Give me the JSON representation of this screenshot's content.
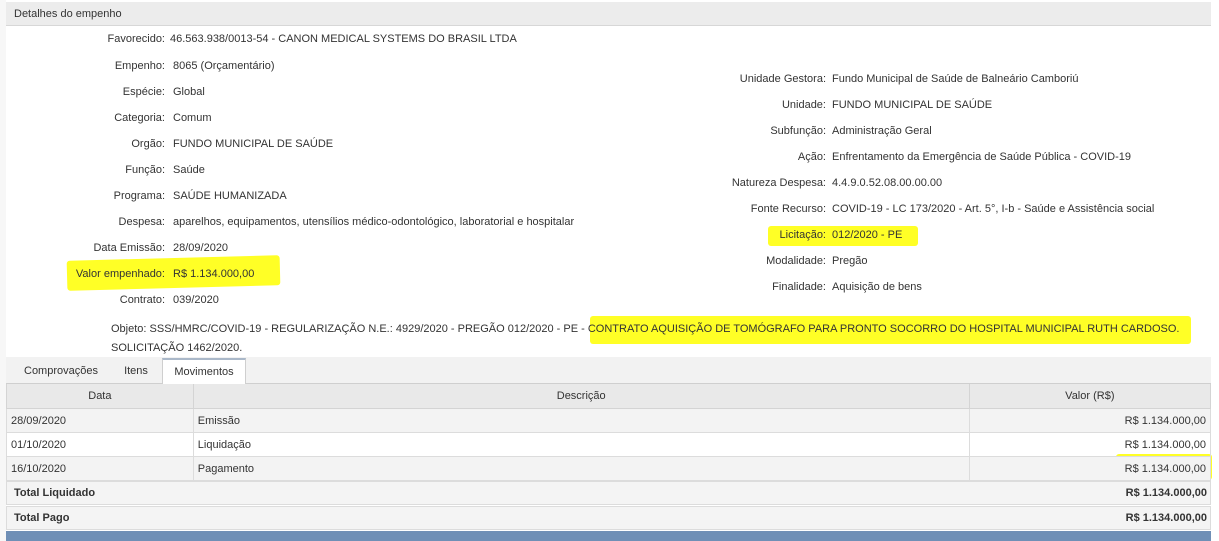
{
  "panel": {
    "title": "Detalhes do empenho"
  },
  "left_fields": [
    {
      "label": "Favorecido:",
      "value": "46.563.938/0013-54 - CANON MEDICAL SYSTEMS DO BRASIL LTDA"
    },
    {
      "label": "Empenho:",
      "value": "8065 (Orçamentário)"
    },
    {
      "label": "Espécie:",
      "value": "Global"
    },
    {
      "label": "Categoria:",
      "value": "Comum"
    },
    {
      "label": "Orgão:",
      "value": "FUNDO MUNICIPAL DE SAÚDE"
    },
    {
      "label": "Função:",
      "value": "Saúde"
    },
    {
      "label": "Programa:",
      "value": "SAÚDE HUMANIZADA"
    },
    {
      "label": "Despesa:",
      "value": "aparelhos, equipamentos, utensílios médico-odontológico, laboratorial e hospitalar"
    },
    {
      "label": "Data Emissão:",
      "value": "28/09/2020"
    },
    {
      "label": "Valor empenhado:",
      "value": "R$ 1.134.000,00"
    },
    {
      "label": "Contrato:",
      "value": "039/2020"
    }
  ],
  "right_fields": [
    {
      "label": "Unidade Gestora:",
      "value": "Fundo Municipal de Saúde de Balneário Camboriú"
    },
    {
      "label": "Unidade:",
      "value": "FUNDO MUNICIPAL DE SAÚDE"
    },
    {
      "label": "Subfunção:",
      "value": "Administração Geral"
    },
    {
      "label": "Ação:",
      "value": "Enfrentamento da Emergência de Saúde Pública - COVID-19"
    },
    {
      "label": "Natureza Despesa:",
      "value": "4.4.9.0.52.08.00.00.00"
    },
    {
      "label": "Fonte Recurso:",
      "value": "COVID-19 - LC 173/2020 - Art. 5°, I-b - Saúde e Assistência social"
    },
    {
      "label": "Licitação:",
      "value": "012/2020 - PE"
    },
    {
      "label": "Modalidade:",
      "value": "Pregão"
    },
    {
      "label": "Finalidade:",
      "value": "Aquisição de bens"
    }
  ],
  "objeto": {
    "label": "Objeto:",
    "text_plain": "SSS/HMRC/COVID-19 - REGULARIZAÇÃO N.E.: 4929/2020 - PREGÃO 012/2020 - PE - ",
    "text_highlight": "CONTRATO AQUISIÇÃO DE TOMÓGRAFO PARA PRONTO SOCORRO DO HOSPITAL MUNICIPAL RUTH CARDOSO.",
    "text_tail": "SOLICITAÇÃO 1462/2020."
  },
  "tabs": [
    {
      "label": "Comprovações"
    },
    {
      "label": "Itens"
    },
    {
      "label": "Movimentos"
    }
  ],
  "table": {
    "headers": [
      "Data",
      "Descrição",
      "Valor (R$)"
    ],
    "rows": [
      {
        "data": "28/09/2020",
        "descricao": "Emissão",
        "valor": "R$ 1.134.000,00"
      },
      {
        "data": "01/10/2020",
        "descricao": "Liquidação",
        "valor": "R$ 1.134.000,00"
      },
      {
        "data": "16/10/2020",
        "descricao": "Pagamento",
        "valor": "R$ 1.134.000,00"
      }
    ]
  },
  "totals": [
    {
      "label": "Total Liquidado",
      "value": "R$ 1.134.000,00"
    },
    {
      "label": "Total Pago",
      "value": "R$ 1.134.000,00"
    }
  ],
  "colors": {
    "highlight": "#ffff00",
    "footer_bar": "#6f8fb6",
    "tab_active_border": "#aab8c9"
  }
}
